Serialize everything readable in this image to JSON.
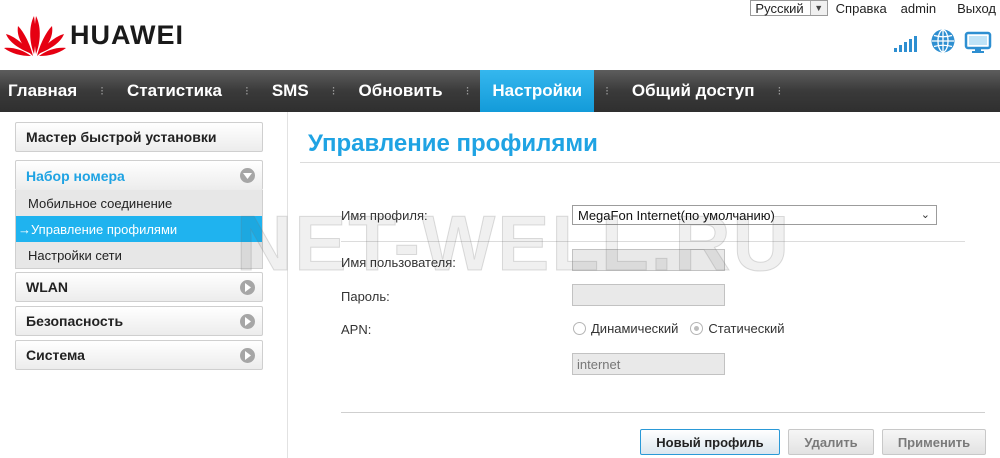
{
  "header": {
    "brand": "HUAWEI",
    "language": "Русский",
    "help": "Справка",
    "user": "admin",
    "logout": "Выход"
  },
  "nav": [
    {
      "label": "Главная"
    },
    {
      "label": "Статистика"
    },
    {
      "label": "SMS"
    },
    {
      "label": "Обновить"
    },
    {
      "label": "Настройки",
      "active": true
    },
    {
      "label": "Общий доступ"
    }
  ],
  "sidebar": {
    "quick_setup": "Мастер быстрой установки",
    "dialup": {
      "label": "Набор номера",
      "items": [
        {
          "label": "Мобильное соединение"
        },
        {
          "label": "→Управление профилями",
          "active": true
        },
        {
          "label": "Настройки сети"
        }
      ]
    },
    "wlan": "WLAN",
    "security": "Безопасность",
    "system": "Система"
  },
  "main": {
    "title": "Управление профилями",
    "profile_label": "Имя профиля:",
    "profile_value": "MegaFon Internet(по умолчанию)",
    "username_label": "Имя пользователя:",
    "username_value": "",
    "password_label": "Пароль:",
    "password_value": "",
    "apn_label": "APN:",
    "apn_dynamic": "Динамический",
    "apn_static": "Статический",
    "apn_selected": "static",
    "apn_value": "internet",
    "new_profile_button": "Новый профиль",
    "delete_button": "Удалить",
    "apply_button": "Применить"
  },
  "watermark": "NET-WELL.RU",
  "colors": {
    "accent": "#1fa3e3",
    "nav_active": "#139bd9",
    "nav_bg": "#3a3a3a",
    "logo_red": "#e60012",
    "icon_blue": "#2e8fd1"
  }
}
